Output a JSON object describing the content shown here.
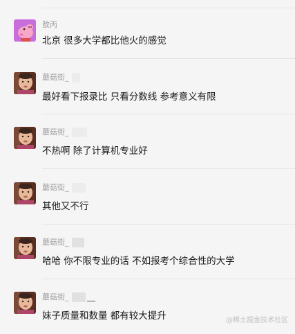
{
  "messages": [
    {
      "sender": "敖丙",
      "avatar": "peppa-pig-icon",
      "text": "北京 很多大学都比他火的感觉"
    },
    {
      "sender": "蘑菇街_",
      "avatar": "child-photo-icon",
      "text": "最好看下报录比  只看分数线  参考意义有限"
    },
    {
      "sender": "蘑菇街_",
      "avatar": "child-photo-icon",
      "text": "不热啊 除了计算机专业好"
    },
    {
      "sender": "蘑菇街_",
      "avatar": "child-photo-icon",
      "text": "其他又不行"
    },
    {
      "sender": "蘑菇街_",
      "avatar": "child-photo-icon",
      "text": "哈哈 你不限专业的话 不如报考个综合性的大学"
    },
    {
      "sender": "蘑菇街_",
      "avatar": "child-photo-icon",
      "text": "妹子质量和数量  都有较大提升"
    }
  ],
  "watermark": "@稀土掘金技术社区",
  "colors": {
    "background": "#f5f5f5",
    "sender": "#a0a0a0",
    "text": "#191919",
    "divider": "#e4e4e4"
  }
}
